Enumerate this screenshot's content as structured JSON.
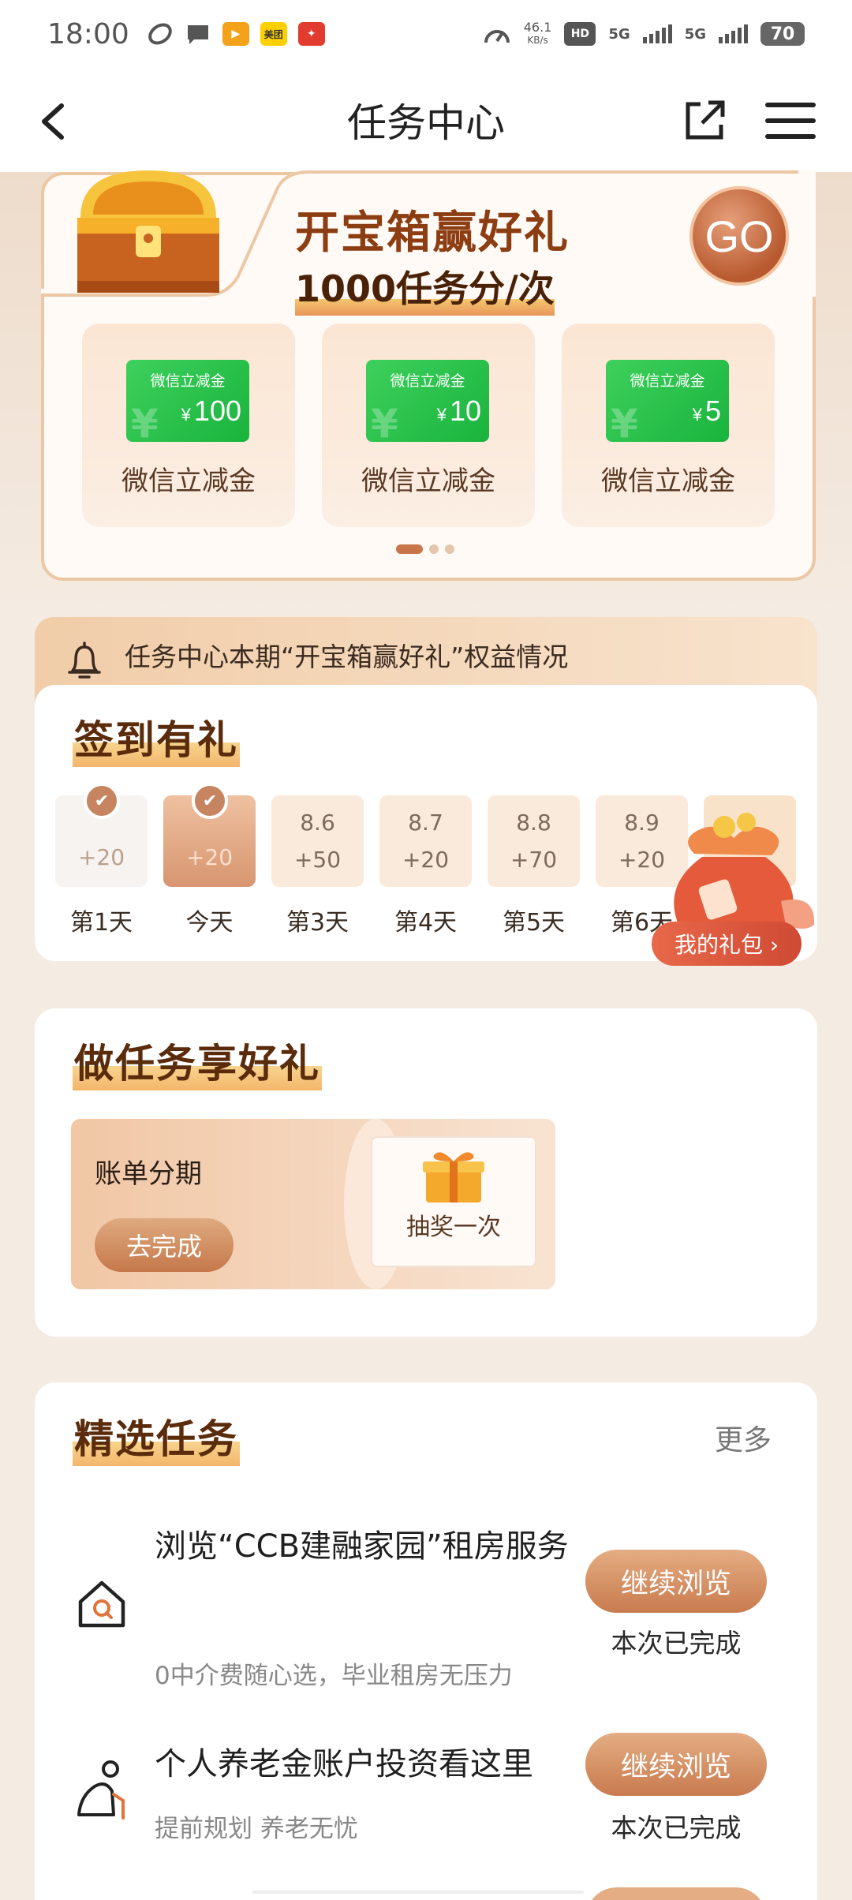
{
  "status_bar": {
    "time": "18:00",
    "net_speed": "46.1",
    "net_unit": "KB/s",
    "hd": "HD",
    "sim1": "5G",
    "sim2": "5G",
    "battery": "70",
    "icons": [
      "link-icon",
      "chat-icon",
      "video-app-icon",
      "meituan-app-icon",
      "news-app-icon"
    ],
    "meituan_label": "美团"
  },
  "header": {
    "title": "任务中心"
  },
  "banner": {
    "title": "开宝箱赢好礼",
    "subtitle": "1000任务分/次",
    "go_label": "GO",
    "rewards": [
      {
        "coupon_label": "微信立减金",
        "currency": "¥",
        "amount": "100",
        "name": "微信立减金"
      },
      {
        "coupon_label": "微信立减金",
        "currency": "¥",
        "amount": "10",
        "name": "微信立减金"
      },
      {
        "coupon_label": "微信立减金",
        "currency": "¥",
        "amount": "5",
        "name": "微信立减金"
      }
    ]
  },
  "notice": {
    "text": "任务中心本期“开宝箱赢好礼”权益情况"
  },
  "signin": {
    "title": "签到有礼",
    "days": [
      {
        "date": "",
        "points": "+20",
        "label": "第1天"
      },
      {
        "date": "",
        "points": "+20",
        "label": "今天"
      },
      {
        "date": "8.6",
        "points": "+50",
        "label": "第3天"
      },
      {
        "date": "8.7",
        "points": "+20",
        "label": "第4天"
      },
      {
        "date": "8.8",
        "points": "+70",
        "label": "第5天"
      },
      {
        "date": "8.9",
        "points": "+20",
        "label": "第6天"
      }
    ],
    "my_gift": "我的礼包 ›"
  },
  "tasks": {
    "title": "做任务享好礼",
    "item": {
      "name": "账单分期",
      "button": "去完成",
      "prize": "抽奖一次"
    }
  },
  "featured": {
    "title": "精选任务",
    "more": "更多",
    "items": [
      {
        "title": "浏览“CCB建融家园”租房服务",
        "desc": "0中介费随心选，毕业租房无压力",
        "button": "继续浏览",
        "status": "本次已完成"
      },
      {
        "title": "个人养老金账户投资看这里",
        "desc": "提前规划 养老无忧",
        "button": "继续浏览",
        "status": "本次已完成"
      }
    ]
  },
  "colors": {
    "accent": "#c87b4e",
    "title_brown": "#8d3d12",
    "coupon_green": "#19b43d",
    "gift_red": "#cf4a33"
  }
}
